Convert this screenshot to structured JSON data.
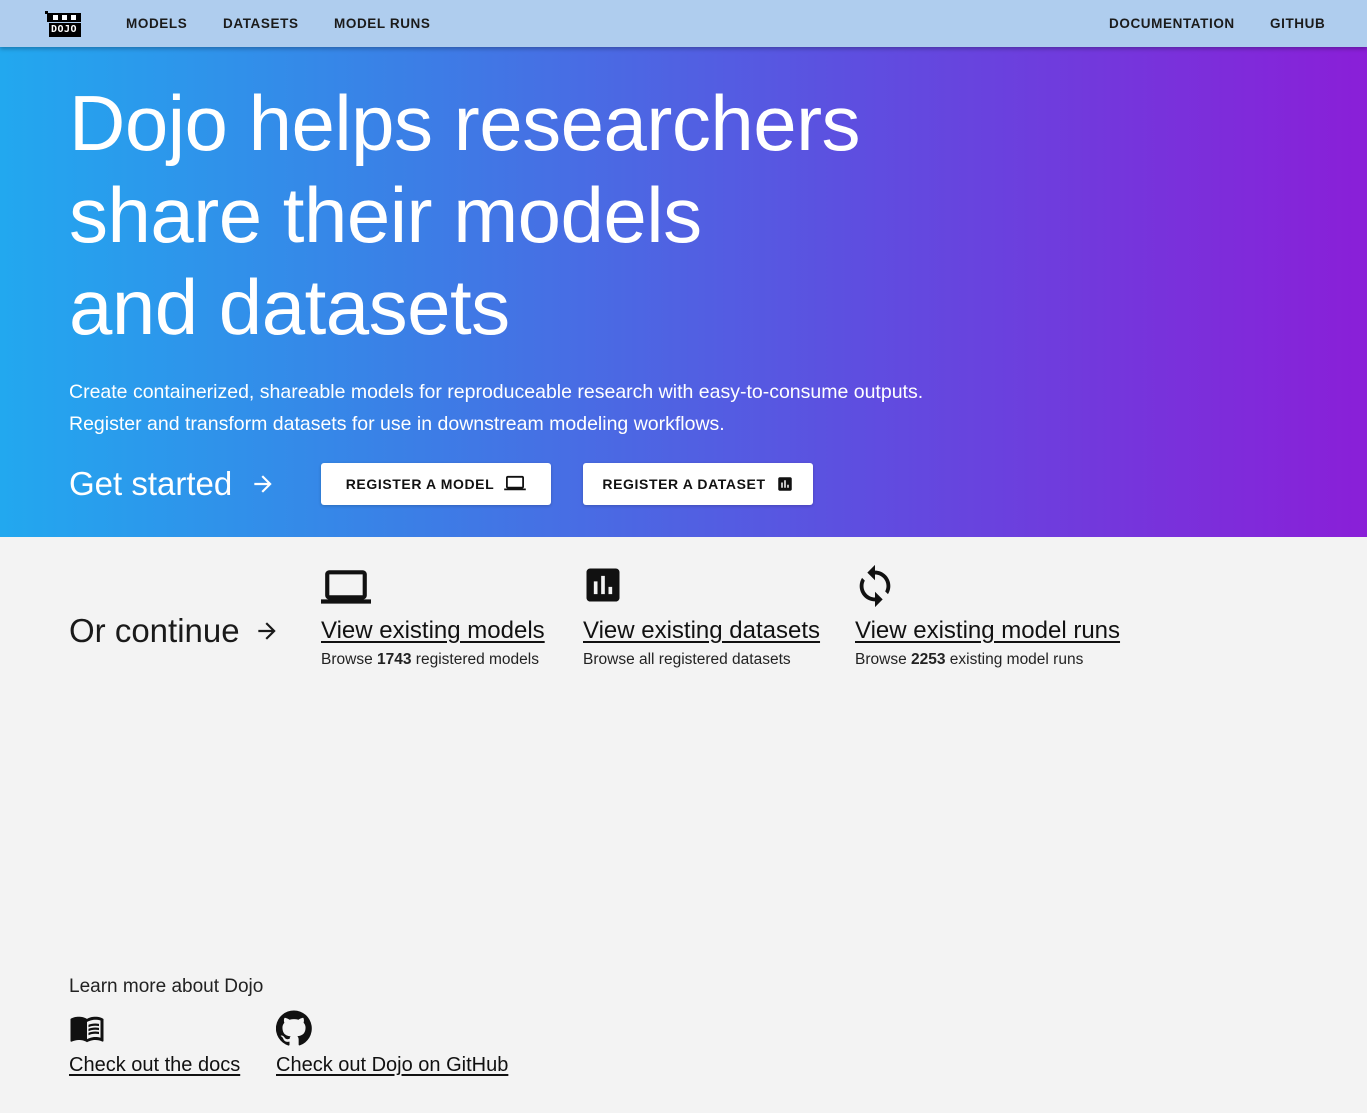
{
  "nav": {
    "logo_text": "DOJO",
    "links": [
      "MODELS",
      "DATASETS",
      "MODEL RUNS"
    ],
    "right_links": [
      "DOCUMENTATION",
      "GITHUB"
    ]
  },
  "hero": {
    "title_lines": [
      "Dojo helps researchers",
      "share their models",
      "and datasets"
    ],
    "subtitle": "Create containerized, shareable models for reproduceable research with easy-to-consume outputs. Register and transform datasets for use in downstream modeling workflows.",
    "get_started": "Get started",
    "register_model": "REGISTER A MODEL",
    "register_dataset": "REGISTER A DATASET",
    "colors": {
      "gradient_start": "#22a8ef",
      "gradient_end": "#8a1fd8"
    }
  },
  "continue": {
    "label": "Or continue",
    "cards": [
      {
        "icon": "laptop-icon",
        "link": "View existing models",
        "desc_prefix": "Browse ",
        "desc_count": "1743",
        "desc_suffix": " registered models"
      },
      {
        "icon": "bar-chart-icon",
        "link": "View existing datasets",
        "desc": "Browse all registered datasets"
      },
      {
        "icon": "sync-icon",
        "link": "View existing model runs",
        "desc_prefix": "Browse ",
        "desc_count": "2253",
        "desc_suffix": " existing model runs"
      }
    ]
  },
  "learn": {
    "title": "Learn more about Dojo",
    "docs_link": "Check out the docs",
    "github_link": "Check out Dojo on GitHub"
  }
}
